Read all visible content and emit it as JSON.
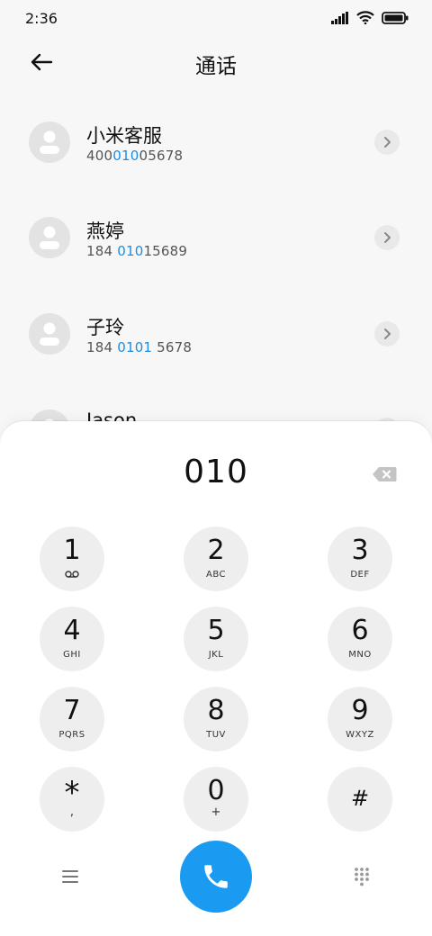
{
  "status": {
    "time": "2:36"
  },
  "header": {
    "title": "通话"
  },
  "contacts": [
    {
      "name": "小米客服",
      "number_before": "400",
      "number_match": "010",
      "number_after": "05678"
    },
    {
      "name": "燕婷",
      "number_before": "184 ",
      "number_match": "010",
      "number_after": "15689"
    },
    {
      "name": "子玲",
      "number_before": "184 ",
      "number_match": "0101",
      "number_after": " 5678"
    },
    {
      "name": "Jason",
      "number_before": "",
      "number_match": "",
      "number_after": ""
    }
  ],
  "dialer": {
    "number": "010",
    "keys": [
      {
        "digit": "1",
        "sub": ""
      },
      {
        "digit": "2",
        "sub": "ABC"
      },
      {
        "digit": "3",
        "sub": "DEF"
      },
      {
        "digit": "4",
        "sub": "GHI"
      },
      {
        "digit": "5",
        "sub": "JKL"
      },
      {
        "digit": "6",
        "sub": "MNO"
      },
      {
        "digit": "7",
        "sub": "PQRS"
      },
      {
        "digit": "8",
        "sub": "TUV"
      },
      {
        "digit": "9",
        "sub": "WXYZ"
      },
      {
        "digit": "*",
        "sub": ","
      },
      {
        "digit": "0",
        "sub": "+"
      },
      {
        "digit": "#",
        "sub": ""
      }
    ]
  },
  "icons": {
    "back": "arrow-left-icon",
    "chevron": "chevron-right-icon",
    "backspace": "backspace-icon",
    "voicemail": "voicemail-icon",
    "menu": "menu-icon",
    "call": "phone-icon",
    "keypad": "keypad-icon"
  },
  "colors": {
    "accent": "#1a9af0",
    "match_highlight": "#1a8ee6",
    "background": "#f7f7f7",
    "key_background": "#eeeeee"
  }
}
